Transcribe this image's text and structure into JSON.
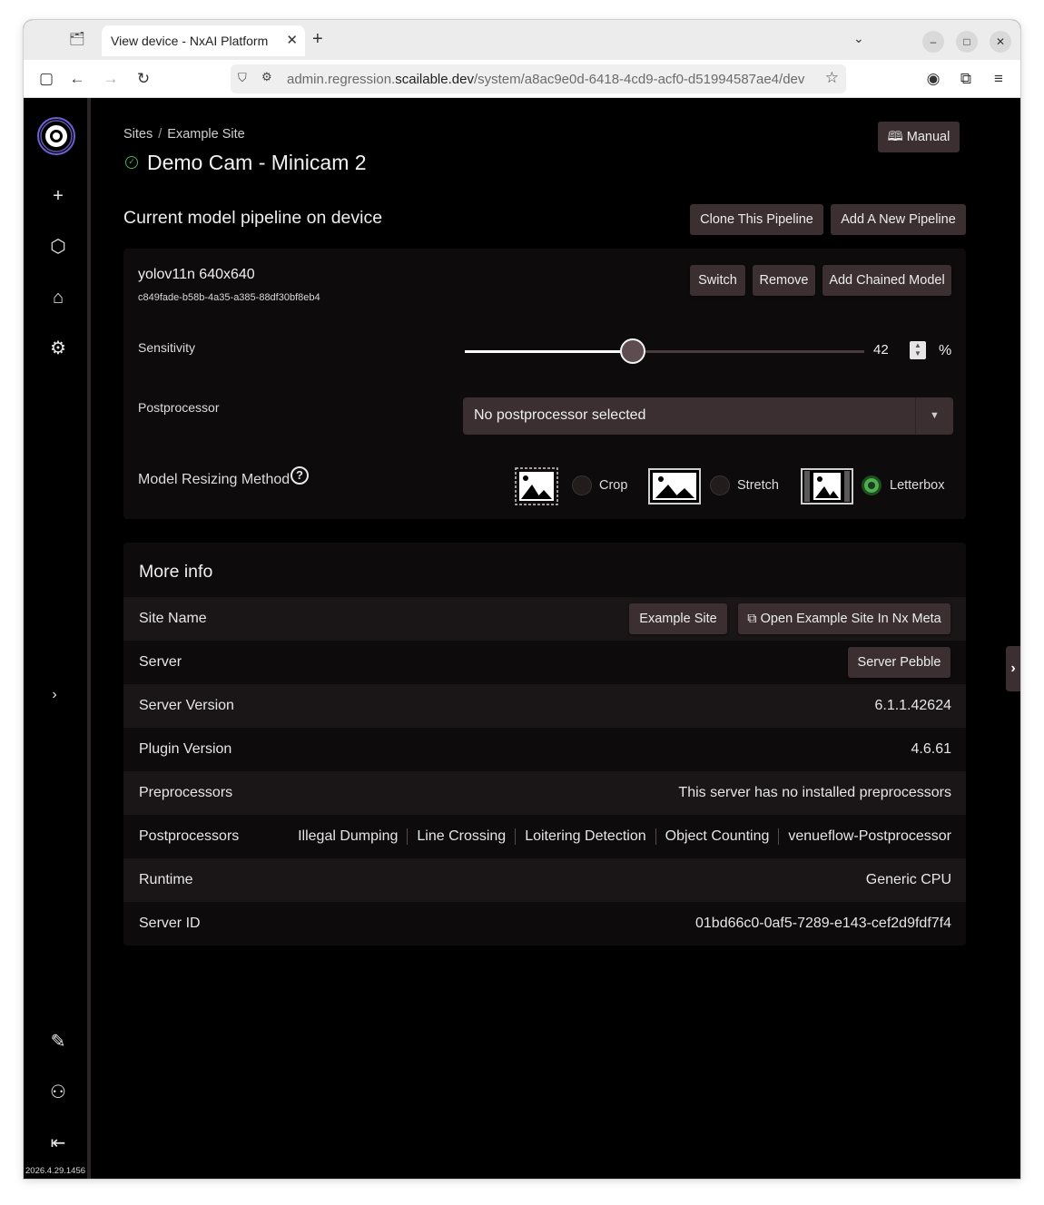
{
  "browser": {
    "tab_title": "View device - NxAI Platform",
    "url_prefix": "admin.regression.",
    "url_domain": "scailable.dev",
    "url_path": "/system/a8ac9e0d-6418-4cd9-acf0-d51994587ae4/dev"
  },
  "breadcrumb": {
    "level1": "Sites",
    "separator": "/",
    "level2": "Example Site"
  },
  "device": {
    "title": "Demo Cam - Minicam 2",
    "status": "online"
  },
  "manual_button": "Manual",
  "pipeline": {
    "section_title": "Current model pipeline on device",
    "clone_button": "Clone This Pipeline",
    "add_button": "Add A New Pipeline",
    "model_name": "yolov11n 640x640",
    "model_id": "c849fade-b58b-4a35-a385-88df30bf8eb4",
    "switch_button": "Switch",
    "remove_button": "Remove",
    "add_chained_button": "Add Chained Model",
    "sensitivity_label": "Sensitivity",
    "sensitivity_value": "42",
    "sensitivity_fraction": 0.42,
    "sensitivity_unit": "%",
    "postprocessor_label": "Postprocessor",
    "postprocessor_value": "No postprocessor selected",
    "resize_label": "Model Resizing Method",
    "resize_options": [
      "Crop",
      "Stretch",
      "Letterbox"
    ],
    "resize_selected": "Letterbox"
  },
  "more_info": {
    "title": "More info",
    "site_name_label": "Site Name",
    "site_name_button": "Example Site",
    "open_site_button": "Open Example Site In Nx Meta",
    "server_label": "Server",
    "server_button": "Server Pebble",
    "server_version_label": "Server Version",
    "server_version": "6.1.1.42624",
    "plugin_version_label": "Plugin Version",
    "plugin_version": "4.6.61",
    "preprocessors_label": "Preprocessors",
    "preprocessors_value": "This server has no installed preprocessors",
    "postprocessors_label": "Postprocessors",
    "postprocessors": [
      "Illegal Dumping",
      "Line Crossing",
      "Loitering Detection",
      "Object Counting",
      "venueflow-Postprocessor"
    ],
    "runtime_label": "Runtime",
    "runtime": "Generic CPU",
    "server_id_label": "Server ID",
    "server_id": "01bd66c0-0af5-7289-e143-cef2d9fdf7f4"
  },
  "version": "2026.4.29.1456",
  "colors": {
    "accent_green": "#4caf50",
    "button_bg": "#3b2f31",
    "logo_purple": "#6b5fd6"
  }
}
